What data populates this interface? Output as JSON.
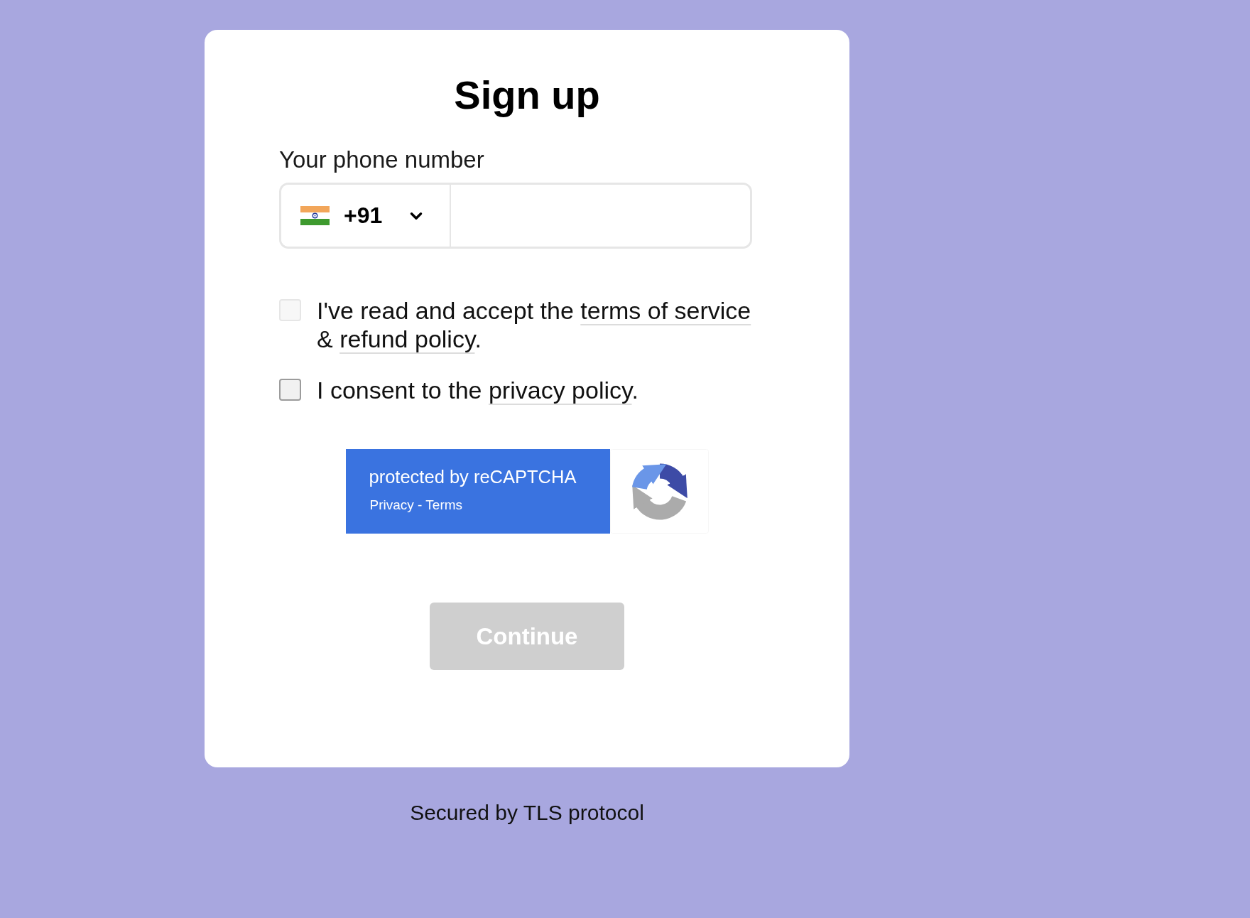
{
  "title": "Sign up",
  "phone": {
    "label": "Your phone number",
    "country_code": "+91"
  },
  "consents": [
    {
      "checked": false,
      "disabled": true,
      "segments": [
        {
          "kind": "text",
          "text": "I've read and accept the "
        },
        {
          "kind": "link",
          "text": "terms of service"
        },
        {
          "kind": "text",
          "text": " & "
        },
        {
          "kind": "link",
          "text": "refund policy"
        },
        {
          "kind": "text",
          "text": "."
        }
      ]
    },
    {
      "checked": false,
      "disabled": false,
      "segments": [
        {
          "kind": "text",
          "text": "I consent to the "
        },
        {
          "kind": "link",
          "text": "privacy policy"
        },
        {
          "kind": "text",
          "text": "."
        }
      ]
    }
  ],
  "recaptcha": {
    "heading": "protected by reCAPTCHA",
    "links": [
      "Privacy",
      "Terms"
    ],
    "separator": " - "
  },
  "continue_button": {
    "label": "Continue",
    "disabled": true
  },
  "footer": "Secured by TLS protocol"
}
